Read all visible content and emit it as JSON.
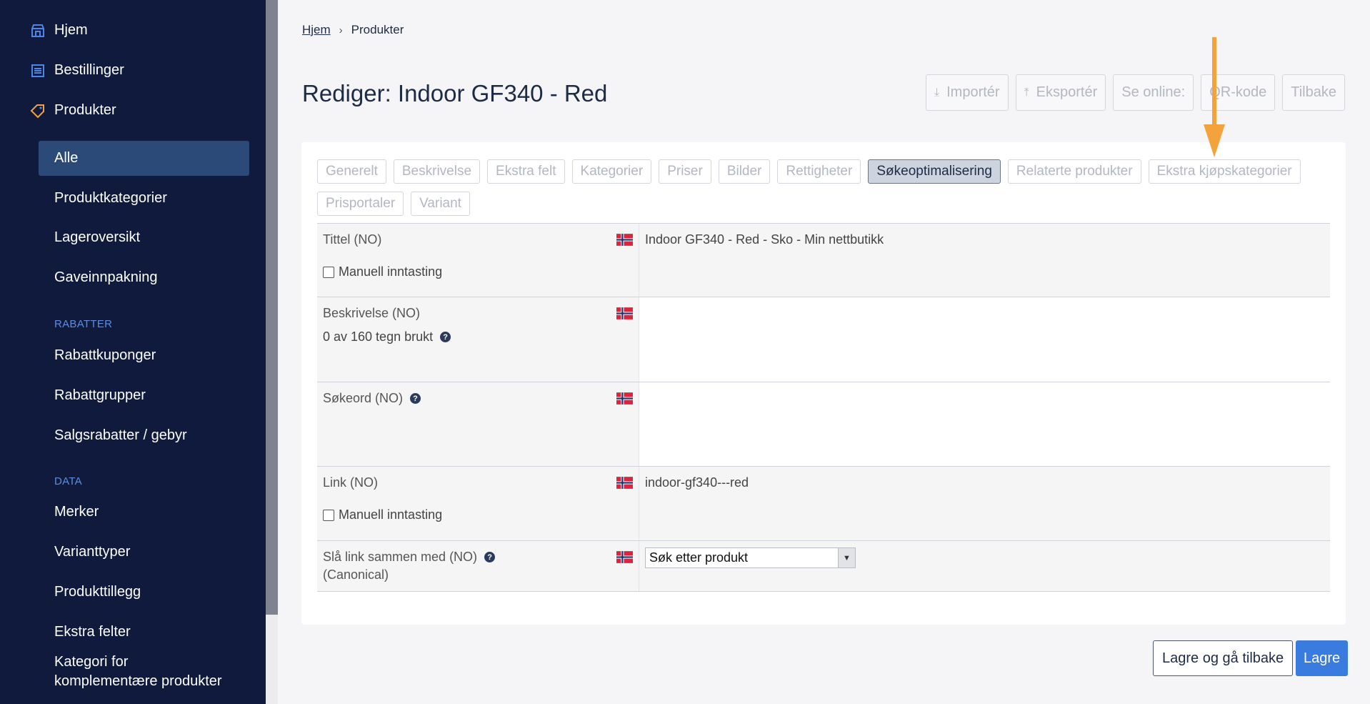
{
  "sidebar": {
    "top": [
      {
        "label": "Hjem",
        "icon": "store-icon"
      },
      {
        "label": "Bestillinger",
        "icon": "orders-icon"
      },
      {
        "label": "Produkter",
        "icon": "tag-icon"
      }
    ],
    "items": [
      "Alle",
      "Produktkategorier",
      "Lageroversikt",
      "Gaveinnpakning"
    ],
    "section_rabatter": "RABATTER",
    "rabatter_items": [
      "Rabattkuponger",
      "Rabattgrupper",
      "Salgsrabatter / gebyr"
    ],
    "section_data": "DATA",
    "data_items": [
      "Merker",
      "Varianttyper",
      "Produkttillegg",
      "Ekstra felter",
      "Kategori for",
      "komplementære produkter"
    ],
    "accent_color": "#2c4a78",
    "bg_color": "#0f1a3d"
  },
  "breadcrumb": {
    "home": "Hjem",
    "current": "Produkter"
  },
  "page_title": "Rediger: Indoor GF340 - Red",
  "toolbar": {
    "import": "Importér",
    "export": "Eksportér",
    "view_online": "Se online:",
    "qr": "QR-kode",
    "back": "Tilbake"
  },
  "tabs": [
    "Generelt",
    "Beskrivelse",
    "Ekstra felt",
    "Kategorier",
    "Priser",
    "Bilder",
    "Rettigheter",
    "Søkeoptimalisering",
    "Relaterte produkter",
    "Ekstra kjøpskategorier",
    "Prisportaler",
    "Variant"
  ],
  "active_tab": "Søkeoptimalisering",
  "rows": {
    "title_label": "Tittel (NO)",
    "title_value": "Indoor GF340 - Red - Sko - Min nettbutikk",
    "manual_entry": "Manuell inntasting",
    "desc_label": "Beskrivelse (NO)",
    "desc_count": "0 av 160 tegn brukt",
    "keywords_label": "Søkeord (NO)",
    "link_label": "Link (NO)",
    "link_value": "indoor-gf340---red",
    "merge_label": "Slå link sammen med (NO)",
    "merge_sub": "(Canonical)",
    "merge_select": "Søk etter produkt"
  },
  "footer": {
    "save_back": "Lagre og gå tilbake",
    "save": "Lagre"
  },
  "colors": {
    "primary": "#3a7be0",
    "arrow": "#f4a23c"
  }
}
